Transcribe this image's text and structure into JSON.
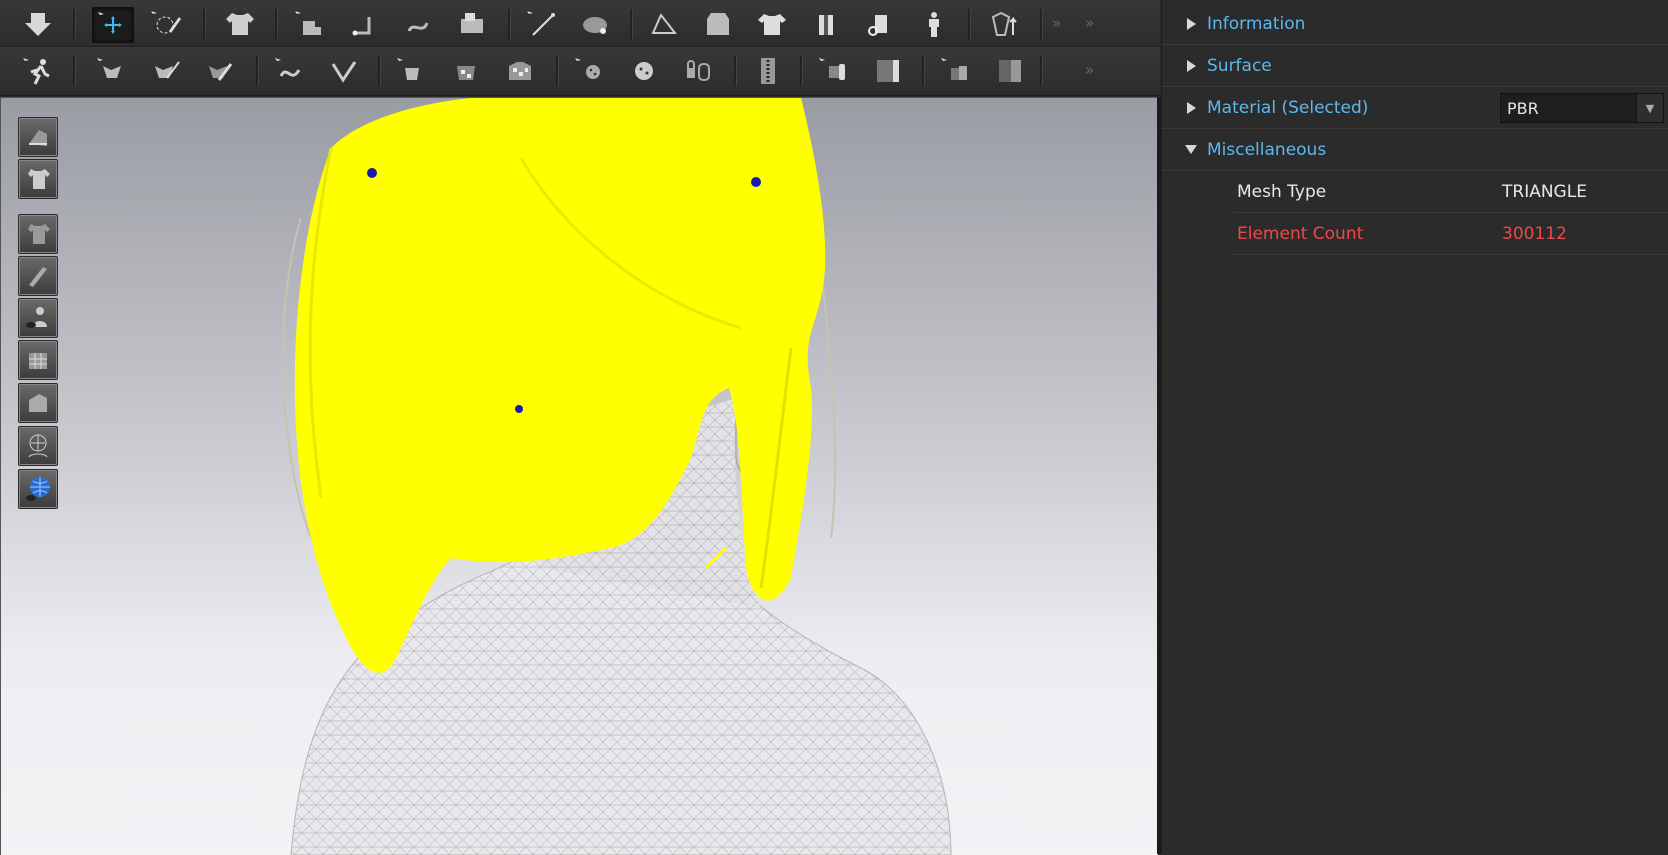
{
  "toolbar_row_1": {
    "icons": [
      "download-arrow-icon",
      "transform-pattern-icon",
      "edit-pattern-icon",
      "garment-icon",
      "segment-point-icon",
      "point-line-icon",
      "curve-point-icon",
      "sewing-machine-icon",
      "needle-icon",
      "fold-icon",
      "layout-icon",
      "jacket-icon",
      "shirt-icon",
      "arrangement-icon",
      "avatar-arrangement-icon",
      "avatar-pose-icon",
      "export-icon"
    ],
    "more": "»"
  },
  "toolbar_row_2": {
    "icons": [
      "walk-icon",
      "pin-pattern-icon",
      "edit-pin-icon",
      "tack-icon",
      "edit-curve-icon",
      "tape-icon",
      "fabric-stitch-icon",
      "fabric-fold-icon",
      "texture-icon",
      "button-icon",
      "button-hole-icon",
      "zipper-lock-icon",
      "zipper-icon",
      "roll-icon",
      "puckering-icon",
      "strip-icon",
      "strip-wide-icon"
    ],
    "more": "»"
  },
  "viewport": {
    "controls": [
      "view-avatar-icon",
      "view-garment-icon",
      "view-shirt-icon",
      "view-pattern-icon",
      "view-avatar-eye-icon",
      "view-grid-icon",
      "view-cube-icon",
      "view-mesh-icon",
      "view-globe-icon"
    ]
  },
  "panel": {
    "sections": {
      "information": "Information",
      "surface": "Surface",
      "material": "Material (Selected)",
      "miscellaneous": "Miscellaneous"
    },
    "material_value": "PBR",
    "mesh_type": {
      "label": "Mesh Type",
      "value": "TRIANGLE"
    },
    "element_count": {
      "label": "Element Count",
      "value": "300112"
    },
    "colors": {
      "section": "#5cb8ee",
      "warning": "#f04848",
      "hair": "#ffff00",
      "point": "#1a1aaa"
    }
  }
}
